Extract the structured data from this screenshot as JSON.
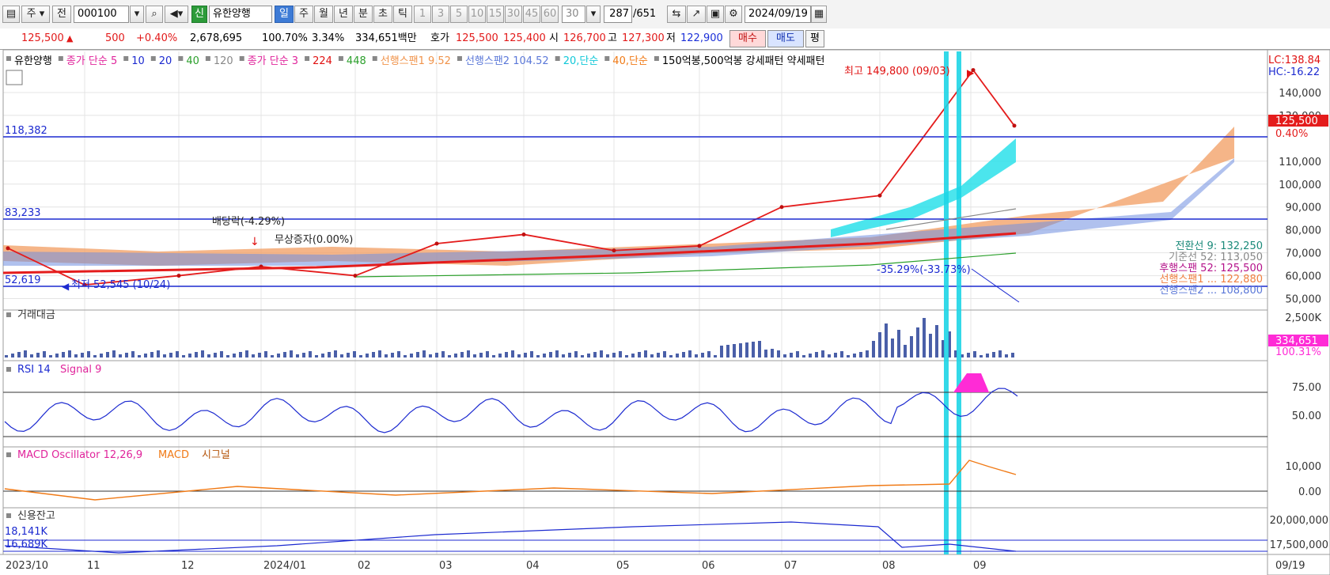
{
  "toolbar": {
    "market": "주",
    "prev_label": "전",
    "code": "000100",
    "new_badge": "신",
    "name": "유한양행",
    "periods": [
      "일",
      "주",
      "월",
      "년",
      "분",
      "초",
      "틱"
    ],
    "selected_period": "일",
    "intervals": [
      "1",
      "3",
      "5",
      "10",
      "15",
      "30",
      "45",
      "60"
    ],
    "interval_select": "30",
    "count": "287",
    "count_total": "/651",
    "date": "2024/09/19"
  },
  "quote": {
    "price": "125,500",
    "change": "500",
    "change_pct": "+0.40%",
    "volume": "2,678,695",
    "vol_ratio": "100.70%",
    "turnover": "3.34%",
    "amount": "334,651백만",
    "hoga_label": "호가",
    "ask": "125,500",
    "bid": "125,400",
    "open_label": "시",
    "open": "126,700",
    "high_label": "고",
    "high": "127,300",
    "low_label": "저",
    "low": "122,900",
    "buy": "매수",
    "sell": "매도",
    "eval": "평"
  },
  "price_panel": {
    "legend": [
      {
        "text": "유한양행",
        "color": "#000000"
      },
      {
        "text": "종가 단순 5",
        "color": "#e0249b"
      },
      {
        "text": "10",
        "color": "#1c2ad0"
      },
      {
        "text": "20",
        "color": "#1c2ad0"
      },
      {
        "text": "40",
        "color": "#2ca02c"
      },
      {
        "text": "120",
        "color": "#888888"
      },
      {
        "text": "종가 단순 3",
        "color": "#e0249b"
      },
      {
        "text": "224",
        "color": "#e01010"
      },
      {
        "text": "448",
        "color": "#2ca02c"
      },
      {
        "text": "선행스팬1 9.52",
        "color": "#f0934a"
      },
      {
        "text": "선행스팬2 104.52",
        "color": "#5b78d8"
      },
      {
        "text": "20,단순",
        "color": "#11c8d8"
      },
      {
        "text": "40,단순",
        "color": "#f07a16"
      },
      {
        "text": "150억봉,500억봉 강세패턴  약세패턴",
        "color": "#000000"
      }
    ],
    "lc": "LC:138.84",
    "hc": "HC:-16.22",
    "y_ticks": [
      "140,000",
      "130,000",
      "110,000",
      "100,000",
      "90,000",
      "80,000",
      "70,000",
      "60,000",
      "50,000"
    ],
    "current_price_tag": "125,500",
    "current_pct_tag": "0.40%",
    "hline_labels": [
      "118,382",
      "83,233",
      "52,619"
    ],
    "high_annotation": "최고 149,800 (09/03)",
    "low_annotation": "최저 52,545 (10/24)",
    "dividend_annotation": "배당락(-4.29%)",
    "bonus_annotation": "무상증자(0.00%)",
    "drop_annotation": "-35.29%(-33.73%)",
    "ichimoku_labels": [
      {
        "text": "전환선 9: 132,250",
        "color": "#1b8a7a"
      },
      {
        "text": "기준선 52: 113,050",
        "color": "#888888"
      },
      {
        "text": "후행스팬 52: 125,500",
        "color": "#b4128a"
      },
      {
        "text": "선행스팬1 ... 122,880",
        "color": "#f08040"
      },
      {
        "text": "선행스팬2 ... 108,800",
        "color": "#5b78d8"
      }
    ]
  },
  "volume_panel": {
    "title": "거래대금",
    "y_ticks": [
      "2,500K"
    ],
    "value_tag": "334,651",
    "pct_tag": "100.31%"
  },
  "rsi_panel": {
    "title": "RSI 14",
    "signal": "Signal 9",
    "y_ticks": [
      "75.00",
      "50.00"
    ]
  },
  "macd_panel": {
    "title": "MACD Oscillator 12,26,9",
    "macd": "MACD",
    "signal": "시그널",
    "y_ticks": [
      "10,000",
      "0.00"
    ]
  },
  "credit_panel": {
    "title": "신용잔고",
    "left_labels": [
      "18,141K",
      "16,689K"
    ],
    "y_ticks": [
      "20,000,000",
      "17,500,000"
    ]
  },
  "x_axis": {
    "labels": [
      "2023/10",
      "11",
      "12",
      "2024/01",
      "02",
      "03",
      "04",
      "05",
      "06",
      "07",
      "08",
      "09"
    ],
    "right_label": "09/19"
  },
  "chart_data": {
    "type": "line",
    "title": "",
    "xlabel": "",
    "ylabel": "",
    "ylim": [
      45000,
      150000
    ],
    "x": [
      "2023/10",
      "11",
      "12",
      "2024/01",
      "02",
      "03",
      "04",
      "05",
      "06",
      "07",
      "08",
      "09/03",
      "09/19"
    ],
    "series": [
      {
        "name": "유한양행",
        "values": [
          72000,
          56000,
          60000,
          64000,
          60000,
          74000,
          78000,
          71000,
          73000,
          90000,
          95000,
          149800,
          125500
        ]
      }
    ],
    "annotations": [
      "최고 149,800 (09/03)",
      "최저 52,545 (10/24)"
    ]
  }
}
